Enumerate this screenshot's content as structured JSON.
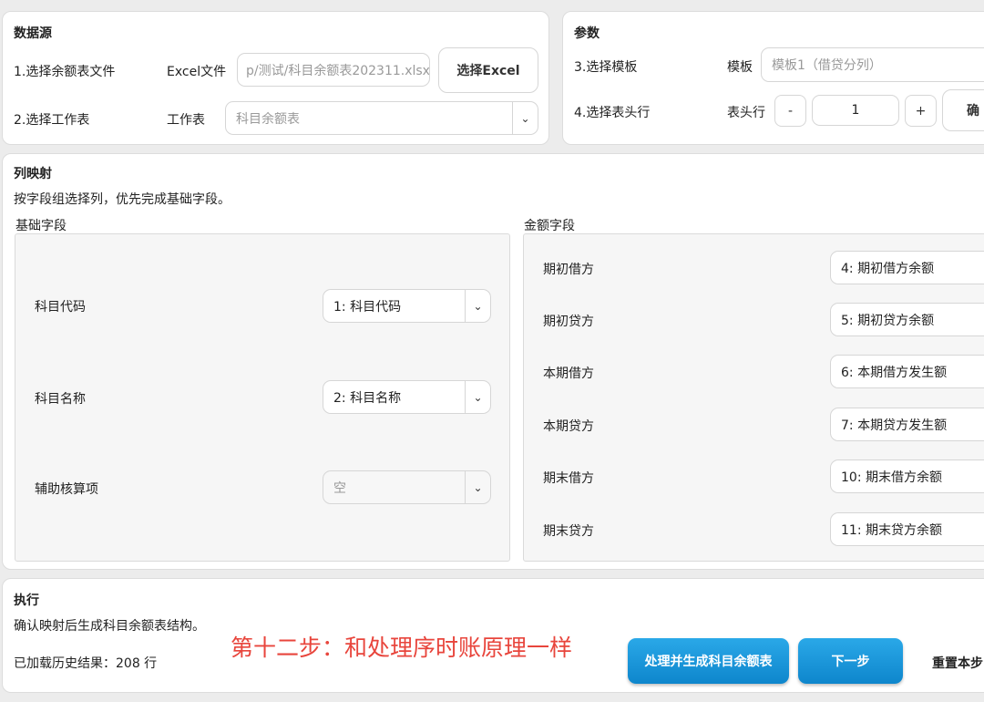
{
  "datasource": {
    "title": "数据源",
    "row1_label": "1.选择余额表文件",
    "excel_label": "Excel文件",
    "excel_path": "p/测试/科目余额表202311.xlsx",
    "select_excel_btn": "选择Excel",
    "row2_label": "2.选择工作表",
    "sheet_label": "工作表",
    "sheet_value": "科目余额表"
  },
  "params": {
    "title": "参数",
    "row1_label": "3.选择模板",
    "template_label": "模板",
    "template_value": "模板1（借贷分列）",
    "row2_label": "4.选择表头行",
    "header_label": "表头行",
    "minus": "-",
    "header_value": "1",
    "plus": "+",
    "confirm_btn": "确"
  },
  "mapping": {
    "title": "列映射",
    "hint": "按字段组选择列，优先完成基础字段。",
    "basic_title": "基础字段",
    "amount_title": "金额字段",
    "basic_fields": [
      {
        "label": "科目代码",
        "value": "1: 科目代码"
      },
      {
        "label": "科目名称",
        "value": "2: 科目名称"
      },
      {
        "label": "辅助核算项",
        "value": "空"
      }
    ],
    "amount_fields": [
      {
        "label": "期初借方",
        "value": "4: 期初借方余额"
      },
      {
        "label": "期初贷方",
        "value": "5: 期初贷方余额"
      },
      {
        "label": "本期借方",
        "value": "6: 本期借方发生额"
      },
      {
        "label": "本期贷方",
        "value": "7: 本期贷方发生额"
      },
      {
        "label": "期末借方",
        "value": "10: 期末借方余额"
      },
      {
        "label": "期末贷方",
        "value": "11: 期末贷方余额"
      }
    ]
  },
  "execute": {
    "title": "执行",
    "hint": "确认映射后生成科目余额表结构。",
    "status": "已加载历史结果：208 行",
    "process_btn": "处理并生成科目余额表",
    "next_btn": "下一步",
    "reset_btn": "重置本步"
  },
  "annotation": "第十二步：和处理序时账原理一样",
  "colors": {
    "accent": "#1596d8",
    "annotation": "#e8453c"
  }
}
